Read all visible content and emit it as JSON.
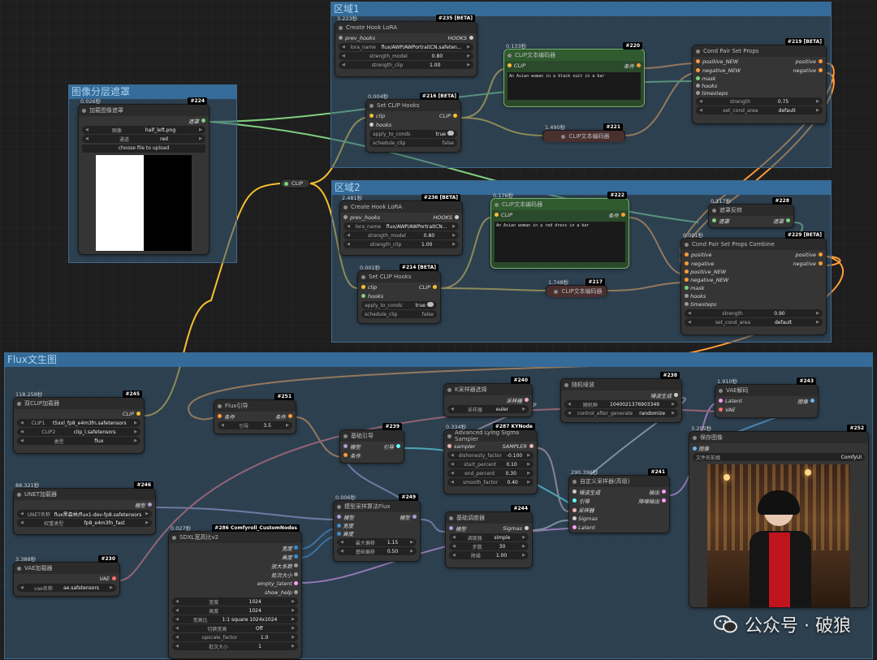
{
  "groups": {
    "region1": "区域1",
    "region2": "区域2",
    "mask_layer": "图像分层遮罩",
    "flux": "Flux文生图"
  },
  "n235": {
    "timing": "3.223秒",
    "badge": "#235 [BETA]",
    "title": "Create Hook LoRA",
    "in": "prev_hooks",
    "out": "HOOKS",
    "lora_label": "lora_name",
    "lora": "flux/AWP/AWPortraitCN.safeten...",
    "sm_label": "strength_model",
    "sm": "0.80",
    "sc_label": "strength_clip",
    "sc": "1.00"
  },
  "n216": {
    "timing": "0.004秒",
    "badge": "#216 [BETA]",
    "title": "Set CLIP Hooks",
    "in1": "clip",
    "in2": "hooks",
    "out": "CLIP",
    "atc_label": "apply_to_conds",
    "atc": "true",
    "sc_label": "schedule_clip",
    "sc": "false"
  },
  "n220": {
    "timing": "0.133秒",
    "badge": "#220",
    "title": "CLIP文本编码器",
    "in": "CLIP",
    "out": "条件",
    "text": "An Asian woman  in a black suit in a bar"
  },
  "n221": {
    "timing": "1.490秒",
    "badge": "#221",
    "title": "CLIP文本编码器"
  },
  "n219": {
    "badge": "#219 [BETA]",
    "title": "Cond Pair Set Props",
    "in1": "positive_NEW",
    "in2": "negative_NEW",
    "in3": "mask",
    "in4": "hooks",
    "in5": "timesteps",
    "out1": "positive",
    "out2": "negative",
    "str_label": "strength",
    "str": "0.75",
    "area_label": "set_cond_area",
    "area": "default"
  },
  "n224": {
    "timing": "0.026秒",
    "badge": "#224",
    "title": "加载图像遮罩",
    "out": "遮罩",
    "img_label": "图像",
    "img": "half_left.png",
    "ch_label": "通道",
    "ch": "red",
    "upload": "choose file to upload"
  },
  "reroute": {
    "label": "CLIP"
  },
  "n236": {
    "timing": "2.481秒",
    "badge": "#236 [BETA]",
    "title": "Create Hook LoRA",
    "in": "prev_hooks",
    "out": "HOOKS",
    "lora_label": "lora_name",
    "lora": "flux/AWP/AWPortraitCN...",
    "sm_label": "strength_model",
    "sm": "0.80",
    "sc_label": "strength_clip",
    "sc": "1.00"
  },
  "n214": {
    "timing": "0.001秒",
    "badge": "#214 [BETA]",
    "title": "Set CLIP Hooks",
    "in1": "clip",
    "in2": "hooks",
    "out": "CLIP",
    "atc_label": "apply_to_conds",
    "atc": "true",
    "sc_label": "schedule_clip",
    "sc": "false"
  },
  "n222": {
    "timing": "0.176秒",
    "badge": "#222",
    "title": "CLIP文本编码器",
    "in": "CLIP",
    "out": "条件",
    "text": "An Asian woman in a red dress in a bar"
  },
  "n217": {
    "timing": "1.748秒",
    "badge": "#217",
    "title": "CLIP文本编码器"
  },
  "n228": {
    "timing": "0.117秒",
    "badge": "#228",
    "title": "遮罩反转",
    "in": "遮罩",
    "out": "遮罩"
  },
  "n229": {
    "timing": "0.001秒",
    "badge": "#229 [BETA]",
    "title": "Cond Pair Set Props Combine",
    "in1": "positive",
    "in2": "negative",
    "in3": "positive_NEW",
    "in4": "negative_NEW",
    "in5": "mask",
    "in6": "hooks",
    "in7": "timesteps",
    "out1": "positive",
    "out2": "negative",
    "str_label": "strength",
    "str": "0.90",
    "area_label": "set_cond_area",
    "area": "default"
  },
  "n245": {
    "timing": "118.258秒",
    "badge": "#245",
    "title": "双CLIP加载器",
    "out": "CLIP",
    "c1_label": "CLIP1",
    "c1": "t5xxl_fp8_e4m3fn.safetensors",
    "c2_label": "CLIP2",
    "c2": "clip_l.safetensors",
    "t_label": "类型",
    "t": "flux"
  },
  "n251": {
    "badge": "#251",
    "title": "Flux引导",
    "in": "条件",
    "out": "条件",
    "g_label": "引导",
    "g": "3.5"
  },
  "n239": {
    "badge": "#239",
    "title": "基础引导",
    "in1": "模型",
    "in2": "条件",
    "out": "引导"
  },
  "n240": {
    "badge": "#240",
    "title": "K采样器选择",
    "out": "采样器",
    "s_label": "采样器",
    "s": "euler"
  },
  "n287": {
    "timing": "0.334秒",
    "badge": "#287 KYNode",
    "title": "Advanced Lying Sigma Sampler",
    "in": "sampler",
    "out": "SAMPLER",
    "df_label": "dishonesty_factor",
    "df": "-0.100",
    "sp_label": "start_percent",
    "sp": "0.10",
    "ep_label": "end_percent",
    "ep": "0.30",
    "smp_label": "smooth_factor",
    "smp": "0.40"
  },
  "n238": {
    "badge": "#238",
    "title": "随机噪波",
    "out": "噪波生成",
    "seed_label": "随机种",
    "seed": "1040021376903349",
    "cag_label": "control_after_generate",
    "cag": "randomize"
  },
  "n243": {
    "timing": "1.910秒",
    "badge": "#243",
    "title": "VAE解码",
    "in1": "Latent",
    "in2": "VAE",
    "out": "图像"
  },
  "n252": {
    "timing": "3.255秒",
    "badge": "#252",
    "title": "保存图像",
    "in": "图像",
    "fp_label": "文件名前缀",
    "fp": "ComfyUI"
  },
  "n246": {
    "timing": "88.321秒",
    "badge": "#246",
    "title": "UNET加载器",
    "out": "模型",
    "u_label": "UNET名称",
    "u": "flux黑森林/flux1-dev-fp8.safetensors",
    "w_label": "权重类型",
    "w": "fp8_e4m3fn_fast"
  },
  "n249": {
    "timing": "0.006秒",
    "badge": "#249",
    "title": "模型采样算法Flux",
    "in1": "模型",
    "in2": "宽度",
    "in3": "高度",
    "out": "模型",
    "ms_label": "最大偏移",
    "ms": "1.15",
    "bs_label": "基础偏移",
    "bs": "0.50"
  },
  "n244": {
    "badge": "#244",
    "title": "基础调度器",
    "in": "模型",
    "out": "Sigmas",
    "sc_label": "调度器",
    "sc": "simple",
    "st_label": "步数",
    "st": "30",
    "dn_label": "降噪",
    "dn": "1.00"
  },
  "n241": {
    "timing": "290.396秒",
    "badge": "#241",
    "title": "自定义采样器(高级)",
    "in1": "噪波生成",
    "in2": "引导",
    "in3": "采样器",
    "in4": "Sigmas",
    "in5": "Latent",
    "out1": "输出",
    "out2": "降噪输出"
  },
  "n230": {
    "timing": "3.388秒",
    "badge": "#230",
    "title": "VAE加载器",
    "out": "VAE",
    "v_label": "vae名称",
    "v": "ae.safetensors"
  },
  "n286": {
    "timing": "0.027秒",
    "badge": "#286 Comfyroll_CustomNodes",
    "title": "SDXL宽高比v2",
    "o1": "宽度",
    "o2": "高度",
    "o3": "放大系数",
    "o4": "批次大小",
    "o5": "empty_latent",
    "o6": "show_help",
    "wd_label": "宽度",
    "wd": "1024",
    "ht_label": "高度",
    "ht": "1024",
    "ar_label": "宽高比",
    "ar": "1:1 square 1024x1024",
    "sw_label": "切换宽高",
    "sw": "Off",
    "uf_label": "upscale_factor",
    "uf": "1.0",
    "bs_label": "批次大小",
    "bs": "1"
  },
  "watermark": {
    "text": "公众号 · 破狼"
  },
  "colors": {
    "clip": "#f6c02f",
    "cond": "#ff9c3a",
    "model": "#b29bd8",
    "mask": "#7fd07f",
    "latent": "#ff9cf9",
    "vae": "#ff6e6e",
    "sampler": "#ecb4b4",
    "sigmas": "#cfcfcf",
    "image": "#64b5f6",
    "guider": "#66ffff"
  }
}
